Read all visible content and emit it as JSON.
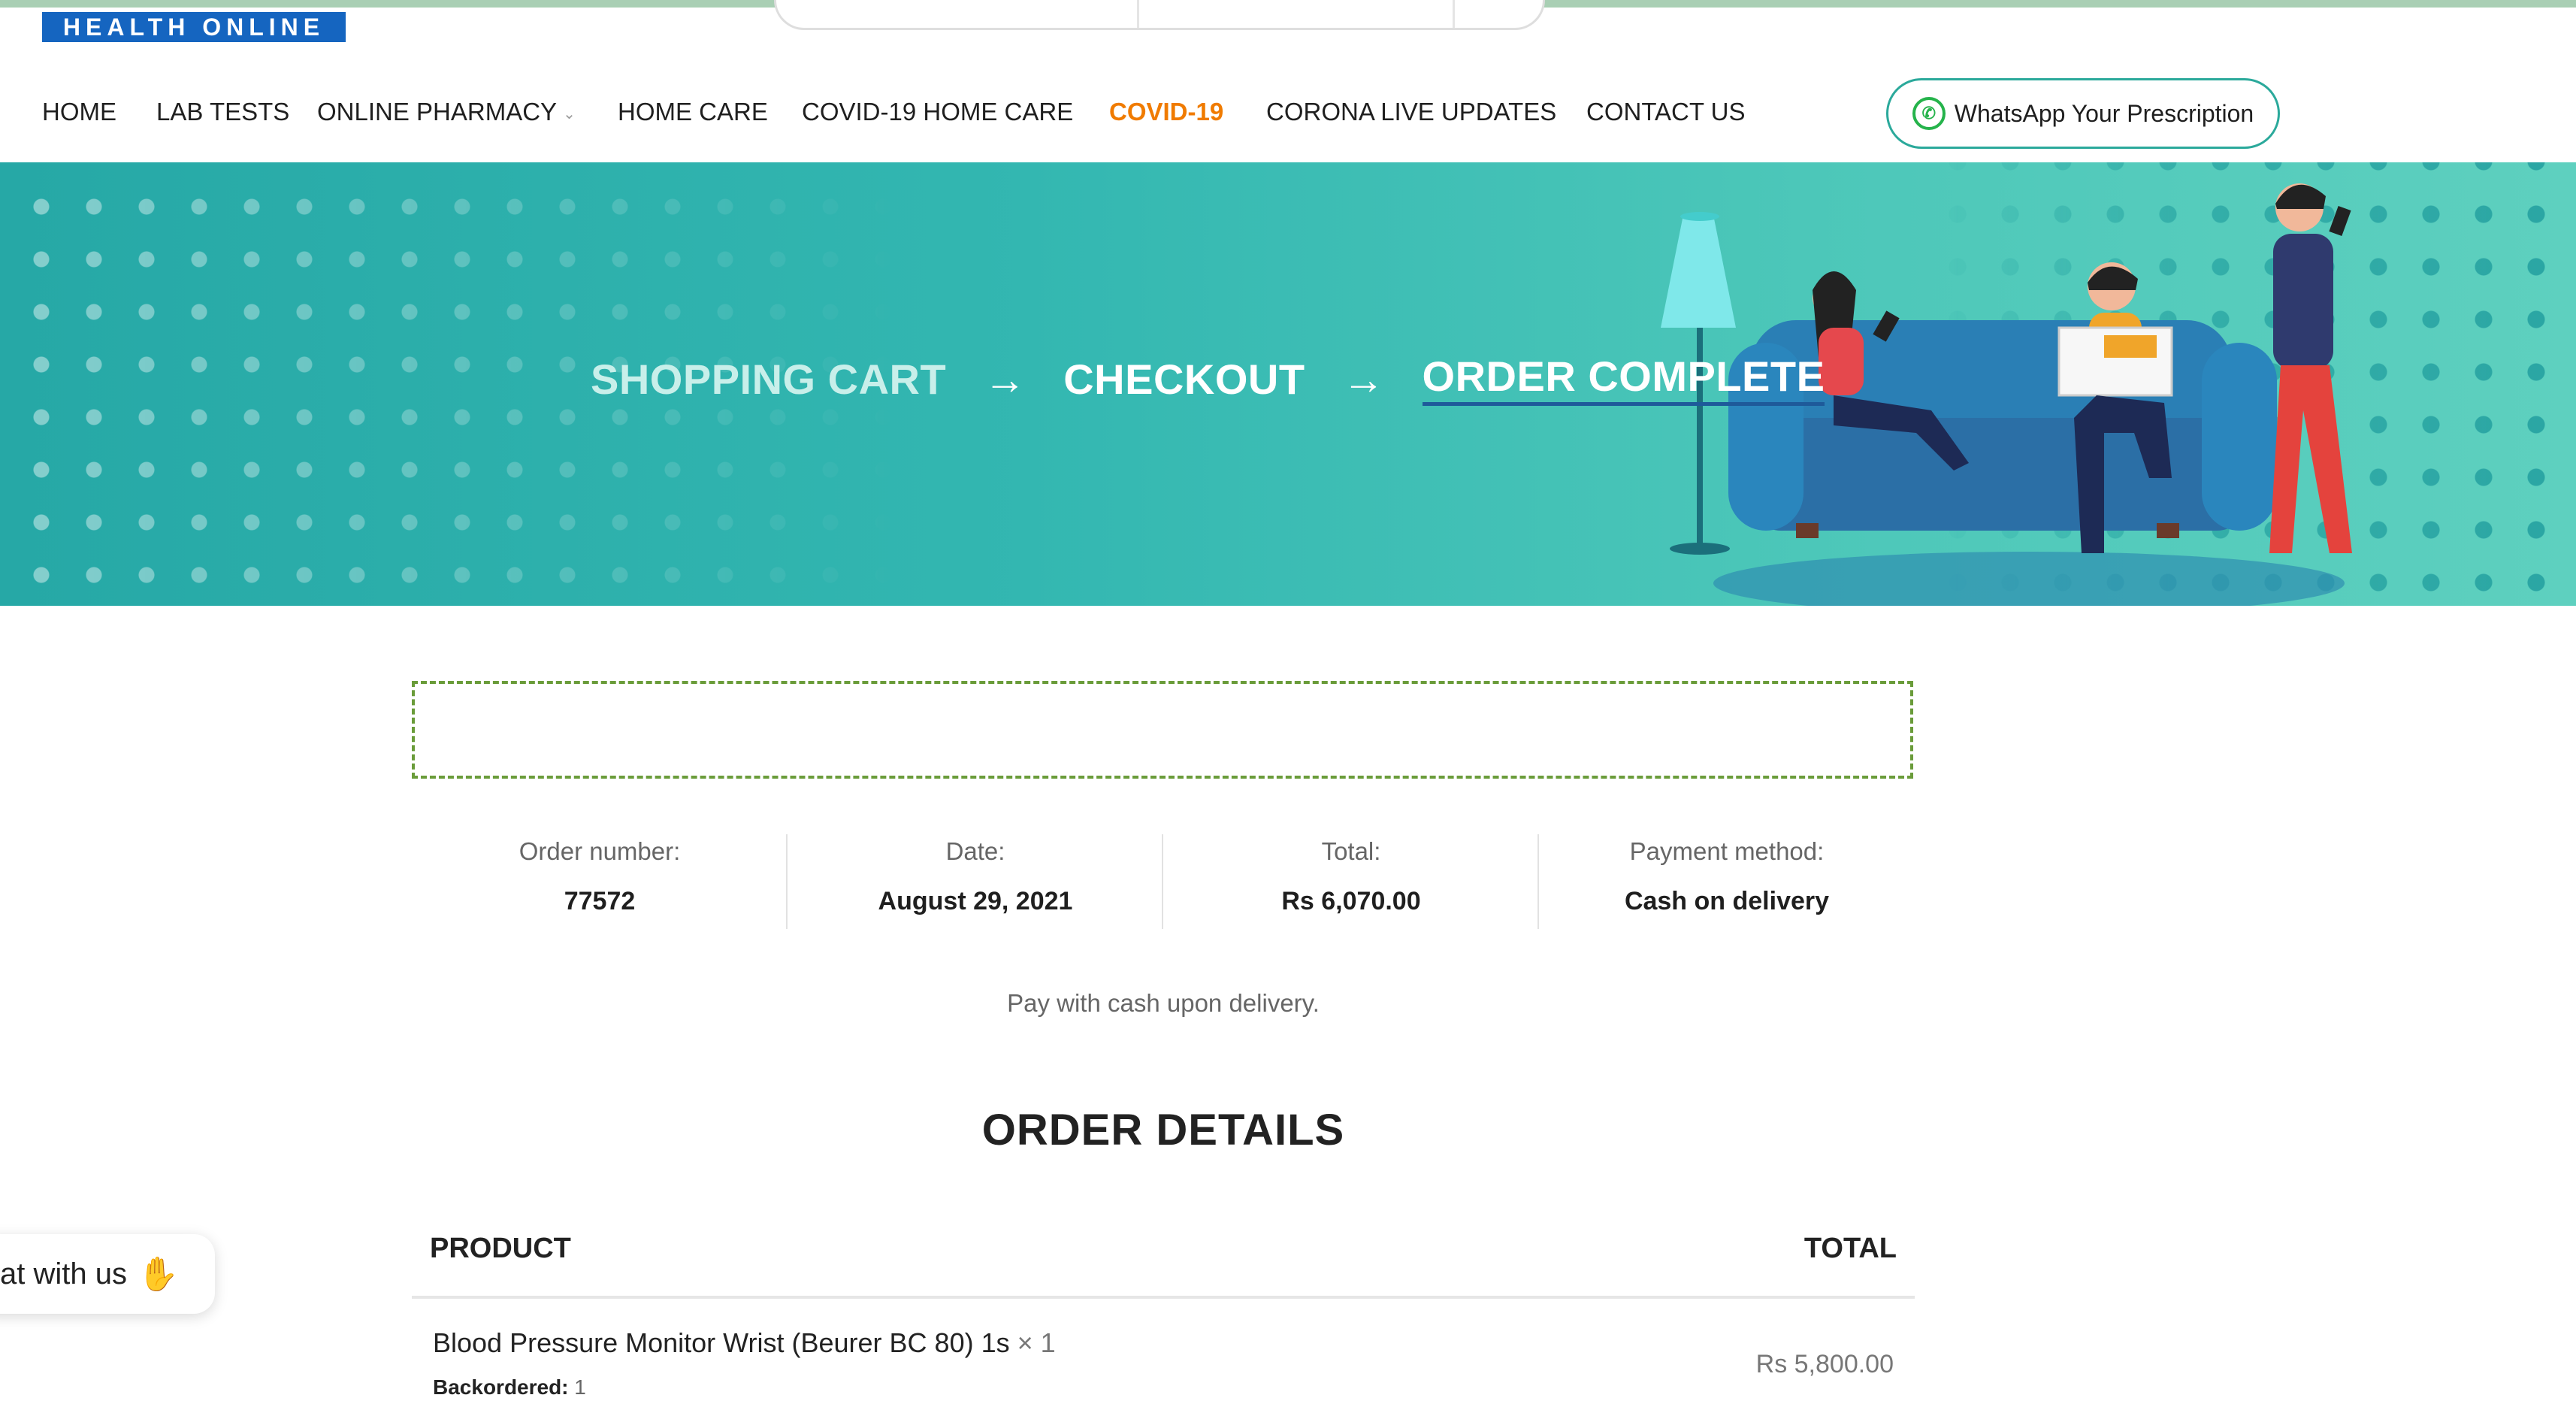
{
  "brand": {
    "logo_text": "HEALTH ONLINE"
  },
  "nav": {
    "items": [
      {
        "label": "HOME"
      },
      {
        "label": "LAB TESTS"
      },
      {
        "label": "ONLINE PHARMACY"
      },
      {
        "label": "HOME CARE"
      },
      {
        "label": "COVID-19 HOME CARE"
      },
      {
        "label": "COVID-19"
      },
      {
        "label": "CORONA LIVE UPDATES"
      },
      {
        "label": "CONTACT US"
      }
    ],
    "whatsapp_label": "WhatsApp Your Prescription"
  },
  "hero": {
    "steps": [
      "SHOPPING CART",
      "CHECKOUT",
      "ORDER COMPLETE"
    ],
    "arrow": "→"
  },
  "overview": [
    {
      "label": "Order number:",
      "value": "77572"
    },
    {
      "label": "Date:",
      "value": "August 29, 2021"
    },
    {
      "label": "Total:",
      "value": "Rs 6,070.00"
    },
    {
      "label": "Payment method:",
      "value": "Cash on delivery"
    }
  ],
  "payment_note": "Pay with cash upon delivery.",
  "order_details": {
    "title": "ORDER DETAILS",
    "columns": {
      "product": "PRODUCT",
      "total": "TOTAL"
    },
    "items": [
      {
        "name": "Blood Pressure Monitor Wrist (Beurer BC 80) 1s",
        "qty": "× 1",
        "meta_label": "Backordered:",
        "meta_value": "1",
        "total": "Rs 5,800.00"
      }
    ]
  },
  "chat_widget": {
    "label": "at with us"
  },
  "colors": {
    "accent_nav": "#f07b00",
    "hero_teal": "#33b7b1",
    "button_border": "#2ba99b",
    "notice_border": "#6a9c3a"
  }
}
